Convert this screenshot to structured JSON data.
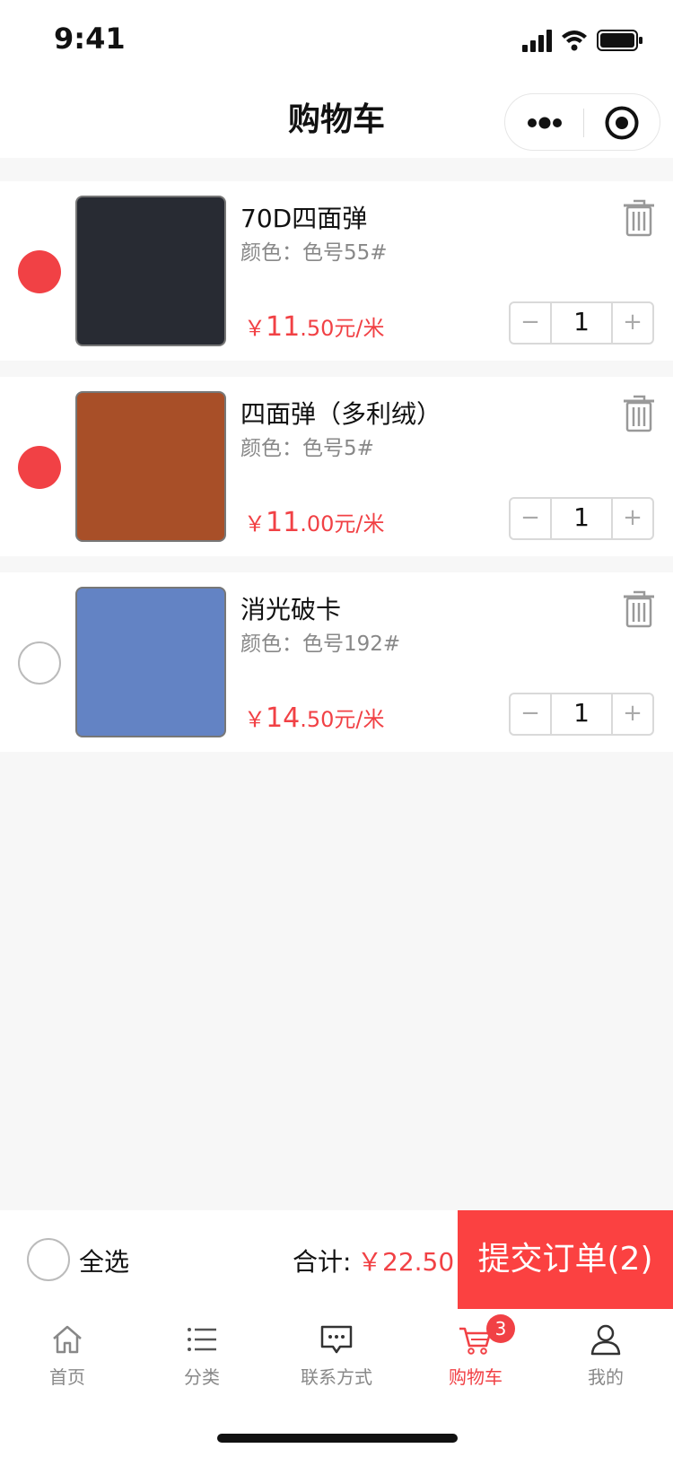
{
  "status_bar": {
    "time": "9:41"
  },
  "nav": {
    "title": "购物车"
  },
  "cart": {
    "items": [
      {
        "name": "70D四面弹",
        "color": "颜色：色号55#",
        "price_symbol": "￥",
        "price_int": "11",
        "price_frac": ".50元/米",
        "qty": "1",
        "checked": true,
        "swatch": "#282b33"
      },
      {
        "name": "四面弹（多利绒）",
        "color": "颜色：色号5#",
        "price_symbol": "￥",
        "price_int": "11",
        "price_frac": ".00元/米",
        "qty": "1",
        "checked": true,
        "swatch": "#a84f28"
      },
      {
        "name": "消光破卡",
        "color": "颜色：色号192#",
        "price_symbol": "￥",
        "price_int": "14",
        "price_frac": ".50元/米",
        "qty": "1",
        "checked": false,
        "swatch": "#6383c4"
      }
    ],
    "stepper_minus": "−",
    "stepper_plus": "+"
  },
  "summary": {
    "select_all": "全选",
    "total_label": "合计:",
    "total_value": "￥22.50",
    "submit": "提交订单(2)"
  },
  "tabbar": {
    "tabs": [
      {
        "label": "首页",
        "icon": "home-icon"
      },
      {
        "label": "分类",
        "icon": "list-icon"
      },
      {
        "label": "联系方式",
        "icon": "message-icon"
      },
      {
        "label": "购物车",
        "icon": "cart-icon",
        "badge": "3",
        "active": true
      },
      {
        "label": "我的",
        "icon": "user-icon"
      }
    ]
  },
  "colors": {
    "accent": "#f14145",
    "submit_bg": "#fb4141"
  }
}
